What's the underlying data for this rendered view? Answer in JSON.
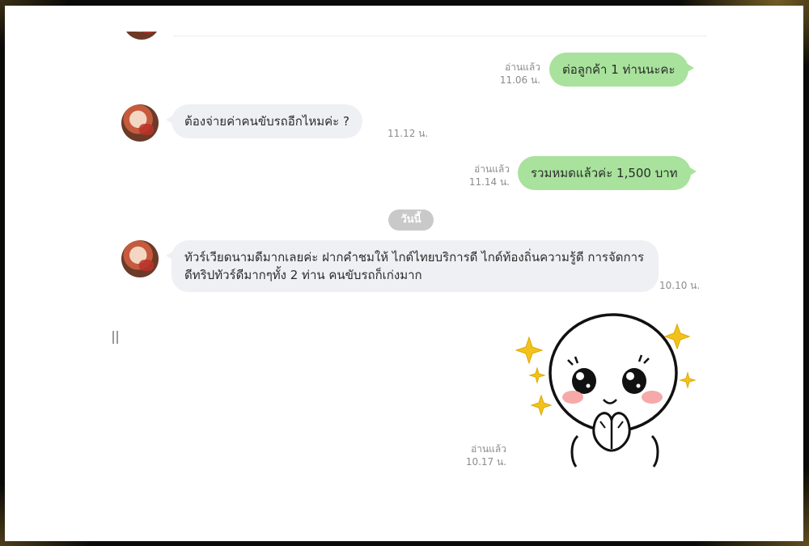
{
  "messages": [
    {
      "from": "me",
      "text": "ต่อลูกค้า 1 ท่านนะคะ",
      "read": "อ่านแล้ว",
      "time": "11.06 น."
    },
    {
      "from": "contact",
      "text": "ต้องจ่ายค่าคนขับรถอีกไหมค่ะ ?",
      "time": "11.12 น."
    },
    {
      "from": "me",
      "text": "รวมหมดแล้วค่ะ 1,500 บาท",
      "read": "อ่านแล้ว",
      "time": "11.14 น."
    },
    {
      "from": "contact",
      "text": "ทัวร์เวียดนามดีมากเลยค่ะ ฝากคำชมให้ ไกด์ไทยบริการดี ไกด์ท้องถิ่นความรู้ดี การจัดการดีทริปทัวร์ดีมากๆทั้ง 2 ท่าน คนขับรถก็เก่งมาก",
      "time": "10.10 น."
    },
    {
      "from": "me",
      "type": "sticker",
      "sticker": "cute-pleading-face-sticker",
      "read": "อ่านแล้ว",
      "time": "10.17 น."
    }
  ],
  "date_divider": "วันนี้",
  "colors": {
    "outgoing_bubble": "#a8e29c",
    "incoming_bubble": "#eef0f3",
    "date_pill": "#c9c9c9",
    "sparkle": "#f2c21b"
  }
}
